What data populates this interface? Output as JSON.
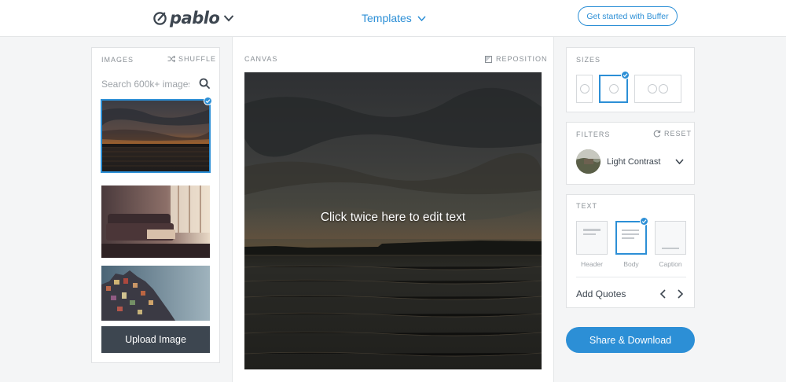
{
  "header": {
    "logo_text": "pablo",
    "templates_label": "Templates",
    "cta_label": "Get started with Buffer"
  },
  "images_panel": {
    "title": "IMAGES",
    "shuffle_label": "SHUFFLE",
    "search_placeholder": "Search 600k+ images",
    "selected_index": 0,
    "upload_label": "Upload Image"
  },
  "canvas": {
    "title": "CANVAS",
    "reposition_label": "REPOSITION",
    "text": "Click twice here to edit text"
  },
  "sizes": {
    "title": "SIZES",
    "options": [
      "pinterest",
      "instagram",
      "facebook-twitter"
    ],
    "selected": "instagram"
  },
  "filters": {
    "title": "FILTERS",
    "reset_label": "RESET",
    "selected_filter": "Light Contrast"
  },
  "text_styles": {
    "title": "TEXT",
    "options": [
      "Header",
      "Body",
      "Caption"
    ],
    "selected": "Body",
    "quotes_label": "Add Quotes"
  },
  "share_label": "Share & Download",
  "colors": {
    "accent": "#2c8fd6",
    "dark": "#3d4650",
    "border": "#e0e2e4"
  }
}
